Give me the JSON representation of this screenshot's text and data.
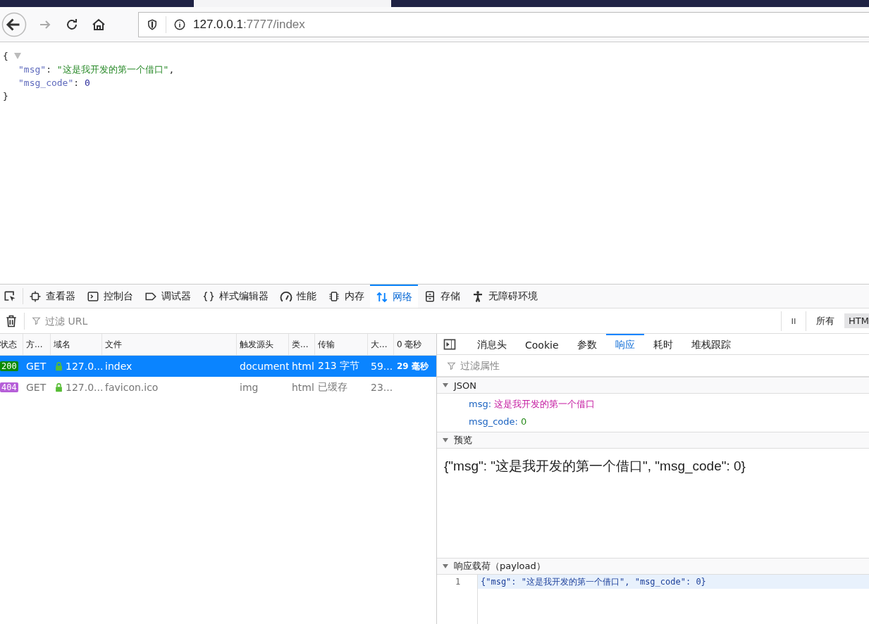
{
  "browser": {
    "url_host": "127.0.0.1",
    "url_rest": ":7777/index"
  },
  "page": {
    "open": "{",
    "expanded": true,
    "close": "}",
    "lines": [
      {
        "key": "\"msg\"",
        "sep": ": ",
        "value": "\"这是我开发的第一个借口\"",
        "trail": ",",
        "kind": "string"
      },
      {
        "key": "\"msg_code\"",
        "sep": ": ",
        "value": "0",
        "kind": "number"
      }
    ]
  },
  "devtools": {
    "tabs": [
      {
        "label": "查看器",
        "selected": false
      },
      {
        "label": "控制台",
        "selected": false
      },
      {
        "label": "调试器",
        "selected": false
      },
      {
        "label": "样式编辑器",
        "selected": false
      },
      {
        "label": "性能",
        "selected": false
      },
      {
        "label": "内存",
        "selected": false
      },
      {
        "label": "网络",
        "selected": true
      },
      {
        "label": "存储",
        "selected": false
      },
      {
        "label": "无障碍环境",
        "selected": false
      }
    ],
    "filter": {
      "placeholder": "过滤 URL"
    },
    "type_filters": [
      {
        "label": "所有",
        "selected": false
      },
      {
        "label": "HTM",
        "selected": true
      }
    ],
    "requests": {
      "columns": [
        "状态",
        "方...",
        "域名",
        "文件",
        "触发源头",
        "类...",
        "传输",
        "大...",
        "0 毫秒"
      ],
      "rows": [
        {
          "status": "200",
          "color": "#0b8a00",
          "method": "GET",
          "domain": "127.0...",
          "file": "index",
          "cause": "document",
          "type": "html",
          "transferred": "213 字节",
          "size": "59...",
          "time": "29 毫秒",
          "selected": true,
          "greyed": false
        },
        {
          "status": "404",
          "color": "#b65fd8",
          "method": "GET",
          "domain": "127.0...",
          "file": "favicon.ico",
          "cause": "img",
          "type": "html",
          "transferred": "已缓存",
          "size": "23...",
          "selected": false,
          "greyed": true
        }
      ]
    },
    "details": {
      "tabs": [
        {
          "label": "消息头",
          "selected": false
        },
        {
          "label": "Cookie",
          "selected": false
        },
        {
          "label": "参数",
          "selected": false
        },
        {
          "label": "响应",
          "selected": true
        },
        {
          "label": "耗时",
          "selected": false
        },
        {
          "label": "堆栈跟踪",
          "selected": false
        }
      ],
      "filter": {
        "placeholder": "过滤属性"
      },
      "json": {
        "title": "JSON",
        "expanded": true,
        "props": [
          {
            "key": "msg:",
            "value": "这是我开发的第一个借口",
            "kind": "string"
          },
          {
            "key": "msg_code:",
            "value": "0",
            "kind": "number"
          }
        ]
      },
      "preview": {
        "title": "预览",
        "expanded": true,
        "text": "{\"msg\": \"这是我开发的第一个借口\", \"msg_code\": 0}"
      },
      "payload": {
        "title": "响应载荷（payload）",
        "expanded": true,
        "lines": [
          {
            "number": "1",
            "text": "{\"msg\": \"这是我开发的第一个借口\", \"msg_code\": 0}"
          }
        ]
      }
    }
  }
}
